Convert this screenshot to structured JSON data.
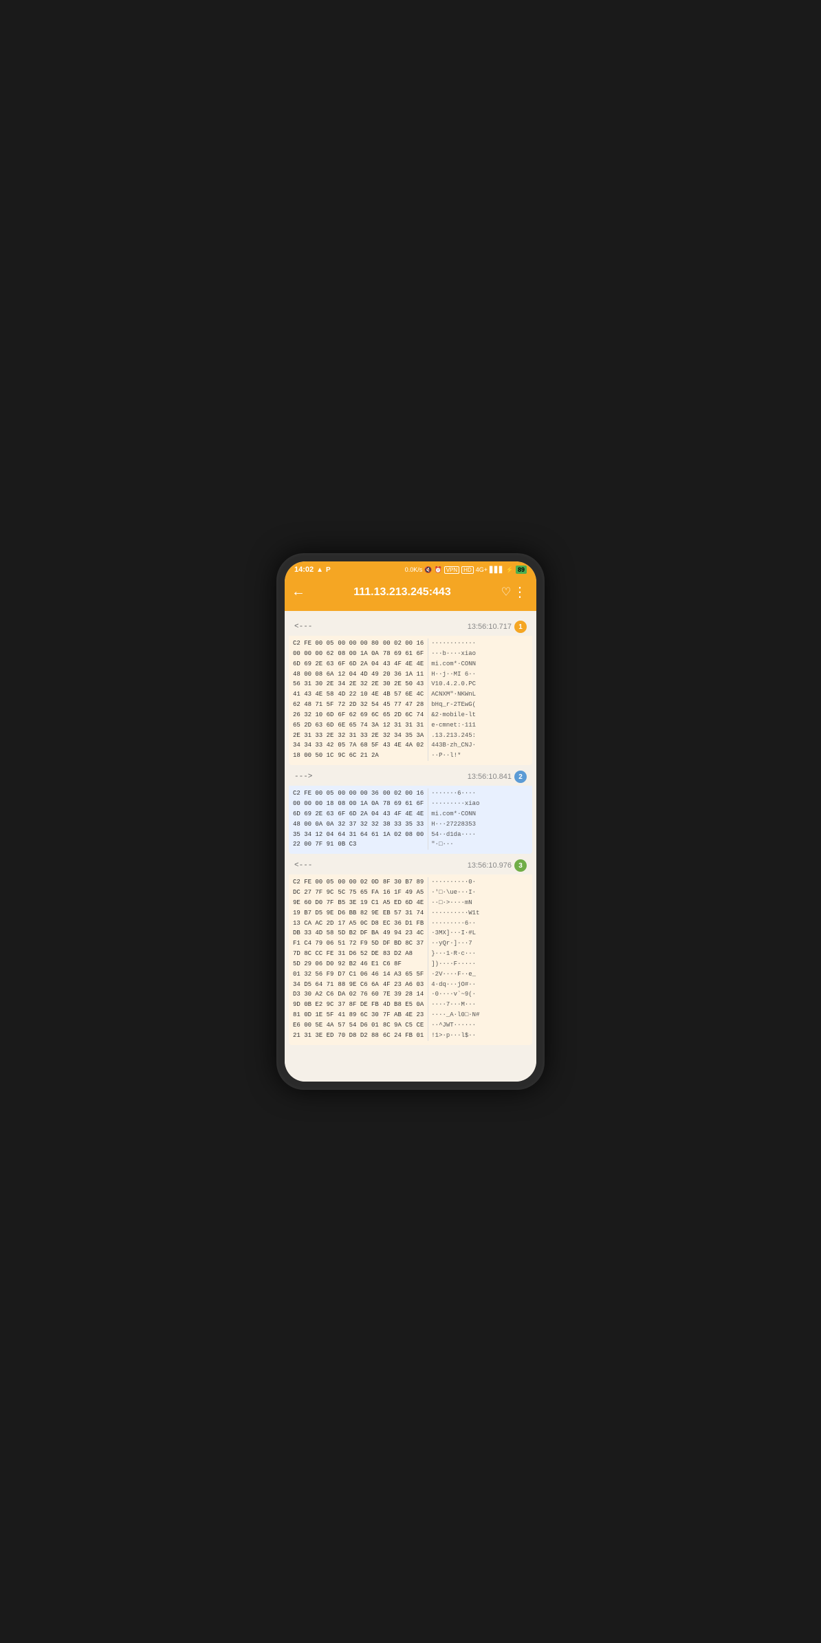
{
  "status_bar": {
    "time": "14:02",
    "speed": "0.0K/s",
    "battery": "89",
    "network": "4G+"
  },
  "top_bar": {
    "title": "111.13.213.245:443",
    "back_label": "←",
    "heart_label": "♡",
    "more_label": "⋮"
  },
  "packets": [
    {
      "direction": "<---",
      "time": "13:56:10.717",
      "badge": "1",
      "badge_class": "orange",
      "type": "incoming",
      "hex_left": "C2 FE 00 05\n00 00 00 62\n6D 69 2E 63\n48 00 08 6A\n56 31 30 2E\n41 43 4E 58\n62 48 71 5F\n26 32 10 6D\n65 2D 63 6D\n2E 31 33 2E\n34 34 33 42\n18 00 50 1C",
      "hex_right": "00 00 00 80\n08 00 1A 0A\n6F 6D 2A 04\n12 04 4D 49\n34 2E 32 2E\n4D 22 10 4E\n72 2D 32 54\n6F 62 69 6C\n6E 65 74 3A\n32 31 33 2E\n05 7A 68 5F\n9C 6C 21 2A",
      "hex_right2": "00 02 00 16\n78 69 61 6F\n43 4F 4E 4E\n20 36 1A 11\n30 2E 50 43\n4B 57 6E 4C\n45 77 47 28\n65 2D 6C 74\n12 31 31 31\n32 34 35 3A\n43 4E 4A 02",
      "ascii": "············\n···b····xiao\nmi.com*·CONN\nH··j··MI 6··\nV10.4.2.0.PC\nACNXM\"·NKWnL\nbHq_r-2TEwG(\n&2·mobile-lt\ne-cmnet:·111\n.13.213.245:\n443B·zh_CNJ·\n··P··l!*"
    },
    {
      "direction": "--->",
      "time": "13:56:10.841",
      "badge": "2",
      "badge_class": "blue",
      "type": "outgoing",
      "hex_left": "C2 FE 00 05\n00 00 00 18\n6D 69 2E 63\n48 00 0A 0A\n35 34 12 04\n22 00 7F 91",
      "hex_right": "00 00 00 36\n08 00 1A 0A\n6F 6D 2A 04\n32 37 32 32\n64 31 64 61\n0B C3",
      "hex_right2": "00 02 00 16\n78 69 61 6F\n43 4F 4E 4E\n38 33 35 33\n1A 02 08 00",
      "ascii": "·······6····\n·········xiao\nmi.com*·CONN\nH···27228353\n54··d1da····\n\"·□···"
    },
    {
      "direction": "<---",
      "time": "13:56:10.976",
      "badge": "3",
      "badge_class": "green",
      "type": "incoming",
      "hex_left": "C2 FE 00 05\nDC 27 7F 9C\n9E 60 D0 7F\n19 B7 D5 9E\n13 CA AC 2D\nDB 33 4D 58\nF1 C4 79 06\n7D 8C CC FE\n5D 29 06 D0\n01 32 56 F9\n34 D5 64 71\nD3 30 A2 C6\n9D 0B E2 9C\n81 0D 1E 5F\nE6 00 5E 4A\n21 31 3E ED",
      "hex_right": "00 00 02 0D\n5C 75 65 FA\nB5 3E 19 C1\nD6 BB 82 9E\n17 A5 0C D8\n5D B2 DF BA\n51 72 F9 5D\n31 D6 52 DE\n92 B2 46 E1\nD7 C1 06 46\n88 9E C6 6A\nDA 02 76 60\n37 8F DE FB\n41 89 6C 30\n57 54 D6 01\n70 D8 D2 88",
      "hex_right2": "8F 30 B7 89\n16 1F 49 A5\nA5 ED 6D 4E\nEB 57 31 74\nEC 36 D1 FB\n49 94 23 4C\nDF BD 8C 37\n83 D2 A8\nC6 8F\n14 A3 65 5F\n4F 23 A6 03\n7E 39 28 14\n4D B8 E5 0A\n7F AB 4E 23\n8C 9A C5 CE\n6C 24 FB 01",
      "ascii": "··········0·\n·'□·\\ue···I·\n··□·>····mN\n··········W1t\n·········6··\n·3MX]···I·#L\n··yQr·]···7\n}···1·R·c···\n])····F·····\n·2V····F··e_\n4·dq···jO#··\n·0····v`~9(·\n····7···M···\n····_A·l0□·N#\n··^JWT······\n!1>·p···l$··"
    }
  ]
}
